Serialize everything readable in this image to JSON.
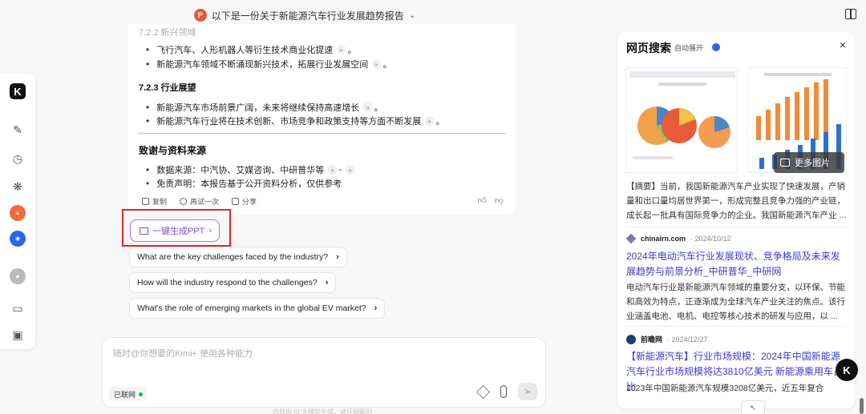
{
  "topbar": {
    "doc_badge": "P",
    "title": "以下是一份关于新能源汽车行业发展趋势报告",
    "chevron": "⌄"
  },
  "rail": {
    "logo": "K"
  },
  "chat": {
    "faded_heading": "7.2.2 新兴领域",
    "bullets_top": [
      {
        "text": "飞行汽车、人形机器人等衍生技术商业化提速",
        "ref": "»",
        "tail": "。"
      },
      {
        "text": "新能源汽车领域不断涌现新兴技术，拓展行业发展空间",
        "ref": "»",
        "tail": "。"
      }
    ],
    "section_723": "7.2.3 行业展望",
    "bullets_mid": [
      {
        "text": "新能源汽车市场前景广阔，未来将继续保持高速增长",
        "ref": "»",
        "tail": "。"
      },
      {
        "text": "新能源汽车行业将在技术创新、市场竞争和政策支持等方面不断发展",
        "ref": "»",
        "tail": "。"
      }
    ],
    "ack_heading": "致谢与资料来源",
    "bullets_ack": [
      {
        "text": "数据来源：中汽协、艾媒咨询、中研普华等",
        "ref": "»",
        "tail": "-",
        "ref2": "»"
      },
      {
        "text": "免责声明：本报告基于公开资料分析，仅供参考",
        "ref": "",
        "tail": ""
      }
    ],
    "actions": {
      "copy": "复制",
      "retry": "再试一次",
      "share": "分享"
    }
  },
  "generate_ppt": {
    "label": "一键生成PPT",
    "arrow": "›"
  },
  "suggestions": [
    "What are the key challenges faced by the industry?",
    "How will the industry respond to the challenges?",
    "What's the role of emerging markets in the global EV market?"
  ],
  "suggestion_arrow": "›",
  "input": {
    "placeholder": "随时@你想要的Kimi+ 使用各种能力",
    "online_label": "已联网",
    "footer": "内容由 AI 大模型生成，请仔细甄别"
  },
  "panel": {
    "title": "网页搜索",
    "auto_expand": "自动展开",
    "close": "×",
    "more_images": "更多图片",
    "first_snippet": "【摘要】当前，我国新能源汽车产业实现了快速发展，产销量和出口量均居世界第一，形成完整且竞争力强的产业链，成长起一批具有国际竞争力的企业。我国新能源汽车产业 ...",
    "results": [
      {
        "source": "chinairn.com",
        "date": "· 2024/10/12",
        "title": "2024年电动汽车行业发展现状、竞争格局及未来发展趋势与前景分析_中研普华_中研网",
        "snippet": "电动汽车行业是新能源汽车领域的重要分支，以环保、节能和高效为特点，正逐渐成为全球汽车产业关注的焦点。该行业涵盖电池、电机、电控等核心技术的研发与应用，以 ..."
      },
      {
        "source": "前瞻网",
        "date": "· 2024/12/27",
        "title": "【新能源汽车】行业市场规模：2024年中国新能源汽车行业市场规模将达3810亿美元 新能源乘用车占比",
        "snippet": "2023年中国新能源汽车规模3208亿美元，近五年复合"
      }
    ]
  },
  "float_logo": "K",
  "bottom_tab": "↖"
}
